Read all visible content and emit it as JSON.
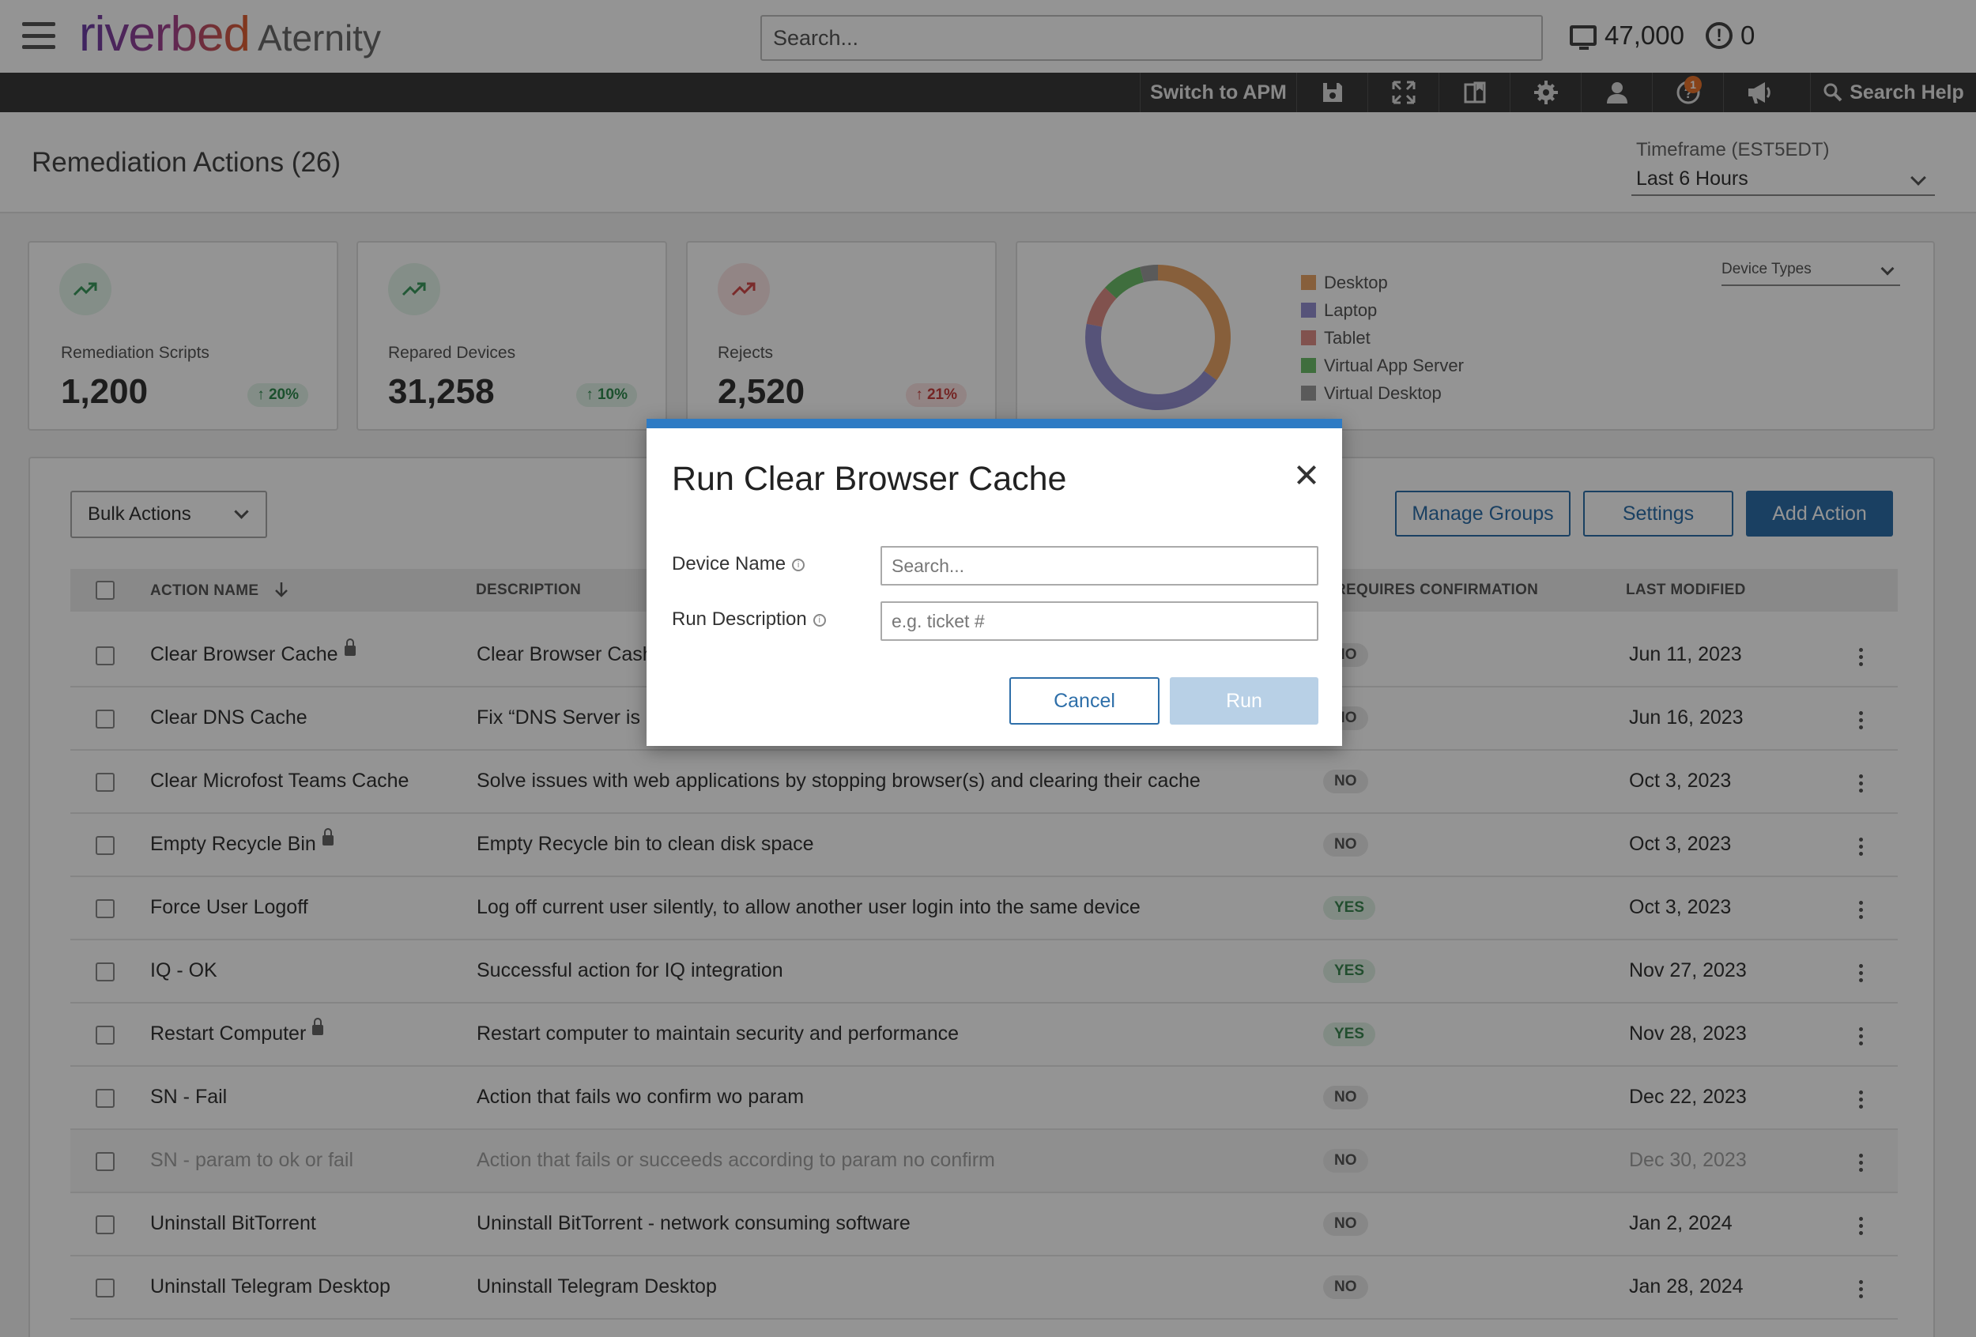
{
  "header": {
    "logo_brand": "riverbed",
    "logo_product": "Aternity",
    "search_placeholder": "Search...",
    "device_count": "47,000",
    "alert_count": "0"
  },
  "toolbar": {
    "switch_label": "Switch to APM",
    "help_badge": "1",
    "search_help": "Search Help"
  },
  "page": {
    "title": "Remediation Actions (26)",
    "timeframe_label": "Timeframe (EST5EDT)",
    "timeframe_value": "Last 6 Hours"
  },
  "kpis": [
    {
      "label": "Remediation Scripts",
      "value": "1,200",
      "delta": "↑ 20%",
      "trend": "up"
    },
    {
      "label": "Repared Devices",
      "value": "31,258",
      "delta": "↑ 10%",
      "trend": "up"
    },
    {
      "label": "Rejects",
      "value": "2,520",
      "delta": "↑ 21%",
      "trend": "down"
    }
  ],
  "device_types": {
    "select_label": "Device Types",
    "legend": [
      {
        "label": "Desktop",
        "color": "#e8a466"
      },
      {
        "label": "Laptop",
        "color": "#9590d0"
      },
      {
        "label": "Tablet",
        "color": "#df8e87"
      },
      {
        "label": "Virtual App Server",
        "color": "#6dbd6a"
      },
      {
        "label": "Virtual Desktop",
        "color": "#9b9b9b"
      }
    ]
  },
  "chart_data": {
    "type": "pie",
    "categories": [
      "Desktop",
      "Laptop",
      "Tablet",
      "Virtual App Server",
      "Virtual Desktop"
    ],
    "values": [
      35,
      43,
      9,
      9,
      4
    ],
    "colors": [
      "#e8a466",
      "#9590d0",
      "#df8e87",
      "#6dbd6a",
      "#9b9b9b"
    ]
  },
  "actions_bar": {
    "bulk_label": "Bulk Actions",
    "manage_groups": "Manage Groups",
    "settings": "Settings",
    "add_action": "Add Action"
  },
  "table": {
    "headers": {
      "name": "ACTION NAME",
      "description": "DESCRIPTION",
      "confirmation": "REQUIRES CONFIRMATION",
      "modified": "LAST MODIFIED"
    },
    "rows": [
      {
        "name": "Clear Browser Cache",
        "locked": true,
        "description": "Clear Browser Cashe",
        "confirm": "NO",
        "date": "Jun 11, 2023"
      },
      {
        "name": "Clear DNS Cache",
        "locked": false,
        "description": "Fix “DNS Server is n",
        "confirm": "NO",
        "date": "Jun 16, 2023"
      },
      {
        "name": "Clear Microfost Teams Cache",
        "locked": false,
        "description": "Solve issues with web applications by stopping browser(s) and clearing their cache",
        "confirm": "NO",
        "date": "Oct 3, 2023"
      },
      {
        "name": "Empty Recycle Bin",
        "locked": true,
        "description": "Empty Recycle bin to clean disk space",
        "confirm": "NO",
        "date": "Oct 3, 2023"
      },
      {
        "name": "Force User Logoff",
        "locked": false,
        "description": "Log off current user silently, to allow another user login into the same device",
        "confirm": "YES",
        "date": "Oct 3, 2023"
      },
      {
        "name": "IQ - OK",
        "locked": false,
        "description": "Successful action for IQ integration",
        "confirm": "YES",
        "date": "Nov 27, 2023"
      },
      {
        "name": "Restart Computer",
        "locked": true,
        "description": "Restart computer to maintain security and performance",
        "confirm": "YES",
        "date": "Nov 28, 2023"
      },
      {
        "name": "SN - Fail",
        "locked": false,
        "description": "Action that fails wo confirm wo param",
        "confirm": "NO",
        "date": "Dec 22, 2023"
      },
      {
        "name": "SN - param to ok or fail",
        "locked": false,
        "description": "Action that fails or succeeds according to param no confirm",
        "confirm": "NO",
        "date": "Dec 30, 2023",
        "dim": true
      },
      {
        "name": "Uninstall BitTorrent",
        "locked": false,
        "description": "Uninstall BitTorrent - network consuming software",
        "confirm": "NO",
        "date": "Jan 2, 2024"
      },
      {
        "name": "Uninstall Telegram Desktop",
        "locked": false,
        "description": "Uninstall Telegram Desktop",
        "confirm": "NO",
        "date": "Jan 28, 2024"
      }
    ]
  },
  "modal": {
    "title": "Run Clear Browser Cache",
    "device_name_label": "Device Name",
    "device_name_placeholder": "Search...",
    "run_description_label": "Run Description",
    "run_description_placeholder": "e.g. ticket #",
    "cancel": "Cancel",
    "run": "Run"
  }
}
